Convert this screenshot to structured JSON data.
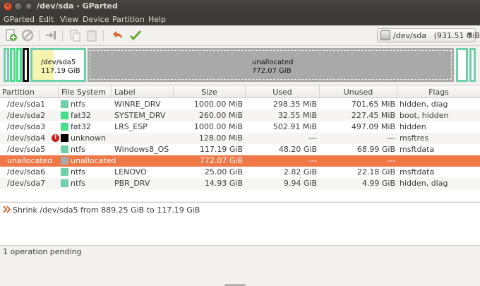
{
  "window": {
    "title": "/dev/sda - GParted"
  },
  "menu": [
    "GParted",
    "Edit",
    "View",
    "Device",
    "Partition",
    "Help"
  ],
  "toolbar": {
    "icons": [
      "new-partition-icon",
      "delete-icon",
      "resize-move-icon",
      "copy-icon",
      "paste-icon",
      "undo-icon",
      "apply-icon"
    ],
    "device": "/dev/sda",
    "device_size": "(931.51 GiB)"
  },
  "diskmap": {
    "sda5": {
      "name": "/dev/sda5",
      "size": "117.19 GiB",
      "used_fraction": 0.41
    },
    "unallocated": {
      "name": "unallocated",
      "size": "772.07 GiB"
    }
  },
  "table": {
    "headers": [
      "Partition",
      "File System",
      "Label",
      "Size",
      "Used",
      "Unused",
      "Flags"
    ],
    "rows": [
      {
        "partition": "/dev/sda1",
        "fs": "ntfs",
        "fs_color": "#6fcfa9",
        "warn": false,
        "label": "WINRE_DRV",
        "size": "1000.00 MiB",
        "used": "298.35 MiB",
        "unused": "701.65 MiB",
        "flags": "hidden, diag"
      },
      {
        "partition": "/dev/sda2",
        "fs": "fat32",
        "fs_color": "#4ade8b",
        "warn": false,
        "label": "SYSTEM_DRV",
        "size": "260.00 MiB",
        "used": "32.55 MiB",
        "unused": "227.45 MiB",
        "flags": "boot, hidden"
      },
      {
        "partition": "/dev/sda3",
        "fs": "fat32",
        "fs_color": "#4ade8b",
        "warn": false,
        "label": "LRS_ESP",
        "size": "1000.00 MiB",
        "used": "502.91 MiB",
        "unused": "497.09 MiB",
        "flags": "hidden"
      },
      {
        "partition": "/dev/sda4",
        "fs": "unknown",
        "fs_color": "#000000",
        "warn": true,
        "label": "",
        "size": "128.00 MiB",
        "used": "---",
        "unused": "---",
        "flags": "msftres"
      },
      {
        "partition": "/dev/sda5",
        "fs": "ntfs",
        "fs_color": "#6fcfa9",
        "warn": false,
        "label": "Windows8_OS",
        "size": "117.19 GiB",
        "used": "48.20 GiB",
        "unused": "68.99 GiB",
        "flags": "msftdata"
      },
      {
        "partition": "unallocated",
        "fs": "unallocated",
        "fs_color": "#a9a9a9",
        "warn": false,
        "label": "",
        "size": "772.07 GiB",
        "used": "---",
        "unused": "---",
        "flags": ""
      },
      {
        "partition": "/dev/sda6",
        "fs": "ntfs",
        "fs_color": "#6fcfa9",
        "warn": false,
        "label": "LENOVO",
        "size": "25.00 GiB",
        "used": "2.82 GiB",
        "unused": "22.18 GiB",
        "flags": "msftdata"
      },
      {
        "partition": "/dev/sda7",
        "fs": "ntfs",
        "fs_color": "#6fcfa9",
        "warn": false,
        "label": "PBR_DRV",
        "size": "14.93 GiB",
        "used": "9.94 GiB",
        "unused": "4.99 GiB",
        "flags": "hidden, diag"
      }
    ],
    "selected_index": 5
  },
  "operations": [
    "Shrink /dev/sda5 from 889.25 GiB to 117.19 GiB"
  ],
  "status": "1 operation pending"
}
